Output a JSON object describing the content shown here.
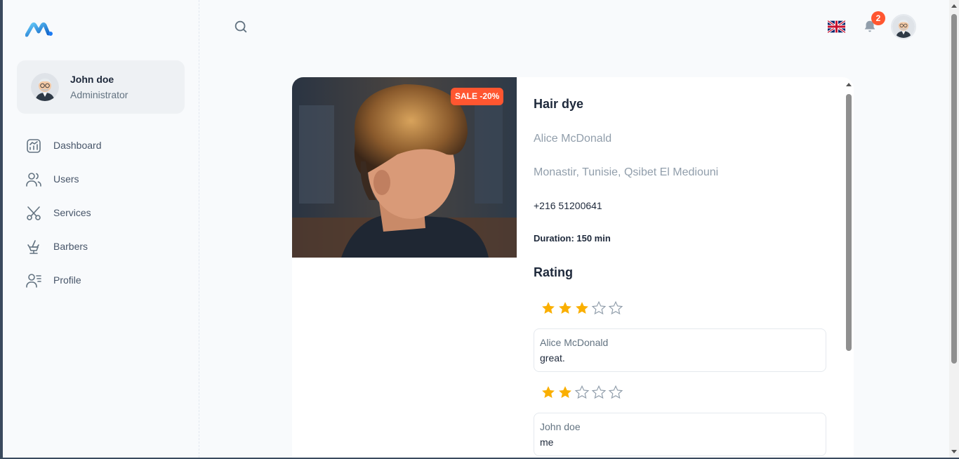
{
  "brand": {
    "logo_icon": "brand-logo-icon",
    "accent": "#1d7bf2"
  },
  "user": {
    "name": "John doe",
    "role": "Administrator",
    "avatar_icon": "avatar-icon"
  },
  "sidebar": {
    "items": [
      {
        "label": "Dashboard",
        "icon": "chart-icon"
      },
      {
        "label": "Users",
        "icon": "users-icon"
      },
      {
        "label": "Services",
        "icon": "scissors-icon"
      },
      {
        "label": "Barbers",
        "icon": "barber-chair-icon"
      },
      {
        "label": "Profile",
        "icon": "profile-icon"
      }
    ]
  },
  "header": {
    "search_icon": "search-icon",
    "language_icon": "uk-flag-icon",
    "notifications": {
      "icon": "bell-icon",
      "count": "2"
    }
  },
  "service": {
    "sale_label": "SALE -20%",
    "title": "Hair dye",
    "owner": "Alice McDonald",
    "address": "Monastir, Tunisie, Qsibet El Mediouni",
    "phone": "+216 51200641",
    "duration": "Duration: 150 min"
  },
  "rating": {
    "title": "Rating",
    "reviews": [
      {
        "stars": 3,
        "max": 5,
        "author": "Alice McDonald",
        "text": "great."
      },
      {
        "stars": 2,
        "max": 5,
        "author": "John doe",
        "text": "me"
      }
    ]
  },
  "colors": {
    "star_filled": "#faaf00",
    "star_empty": "#919eab",
    "sale": "#ff5630"
  }
}
